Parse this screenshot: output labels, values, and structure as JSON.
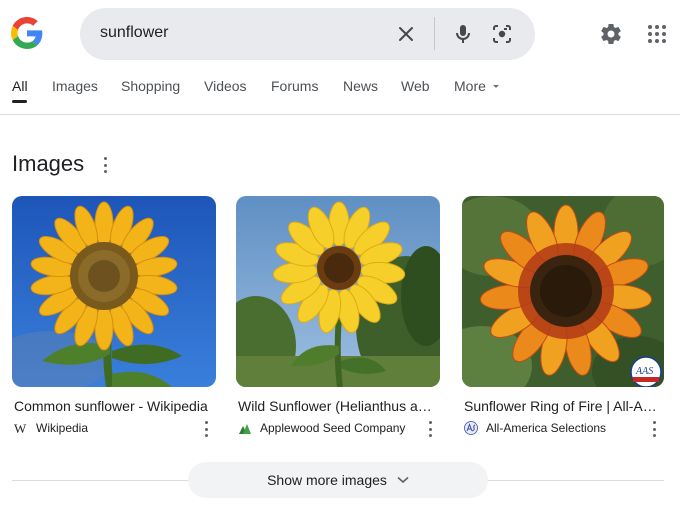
{
  "search": {
    "query": "sunflower"
  },
  "tabs": [
    {
      "label": "All",
      "active": true
    },
    {
      "label": "Images"
    },
    {
      "label": "Shopping"
    },
    {
      "label": "Videos"
    },
    {
      "label": "Forums"
    },
    {
      "label": "News"
    },
    {
      "label": "Web"
    },
    {
      "label": "More"
    }
  ],
  "images_section": {
    "title": "Images",
    "results": [
      {
        "caption": "Common sunflower - Wikipedia",
        "source": "Wikipedia",
        "source_icon": "wikipedia-icon"
      },
      {
        "caption": "Wild Sunflower (Helianthus a…",
        "source": "Applewood Seed Company",
        "source_icon": "applewood-icon"
      },
      {
        "caption": "Sunflower Ring of Fire | All-A…",
        "source": "All-America Selections",
        "source_icon": "aas-icon"
      }
    ],
    "show_more_label": "Show more images",
    "badge_text": "AAS"
  },
  "colors": {
    "accent": "#1a73e8",
    "search_bg": "#e9eaed",
    "text": "#202124",
    "muted": "#4d5156"
  }
}
